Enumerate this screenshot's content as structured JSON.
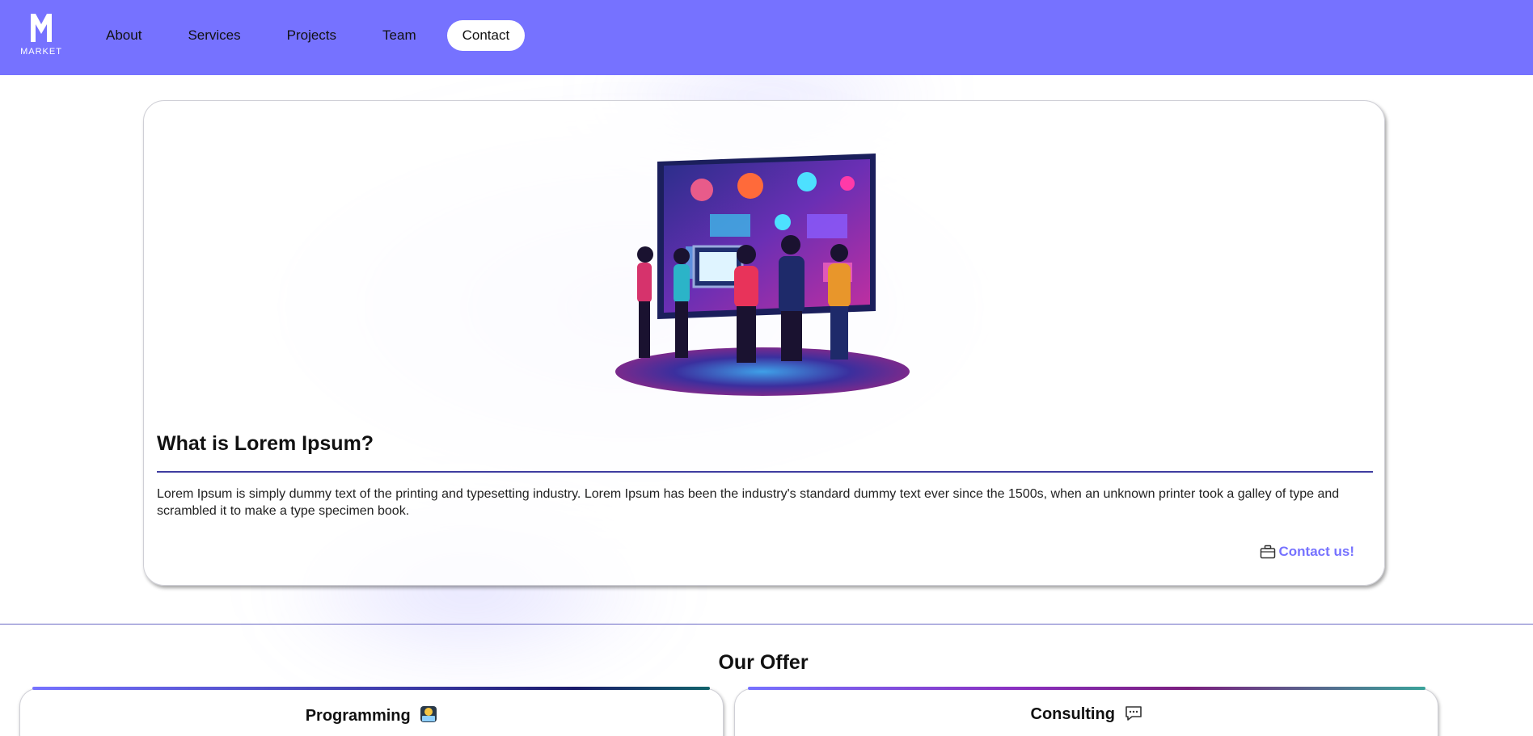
{
  "header": {
    "logo_text": "MARKET",
    "nav": [
      {
        "label": "About"
      },
      {
        "label": "Services"
      },
      {
        "label": "Projects"
      },
      {
        "label": "Team"
      },
      {
        "label": "Contact",
        "active": true
      }
    ]
  },
  "hero": {
    "title": "What is Lorem Ipsum?",
    "body": "Lorem Ipsum is simply dummy text of the printing and typesetting industry. Lorem Ipsum has been the industry's standard dummy text ever since the 1500s, when an unknown printer took a galley of type and scrambled it to make a type specimen book.",
    "contact_label": "Contact us!",
    "contact_icon": "briefcase-icon",
    "illustration": "people-at-digital-screen-illustration"
  },
  "offer": {
    "title": "Our Offer",
    "cards": [
      {
        "label": "Programming",
        "icon": "programmer-emoji-icon"
      },
      {
        "label": "Consulting",
        "icon": "speech-bubble-icon"
      }
    ]
  },
  "colors": {
    "accent": "#7672ff",
    "divider": "#3e3ca0"
  }
}
